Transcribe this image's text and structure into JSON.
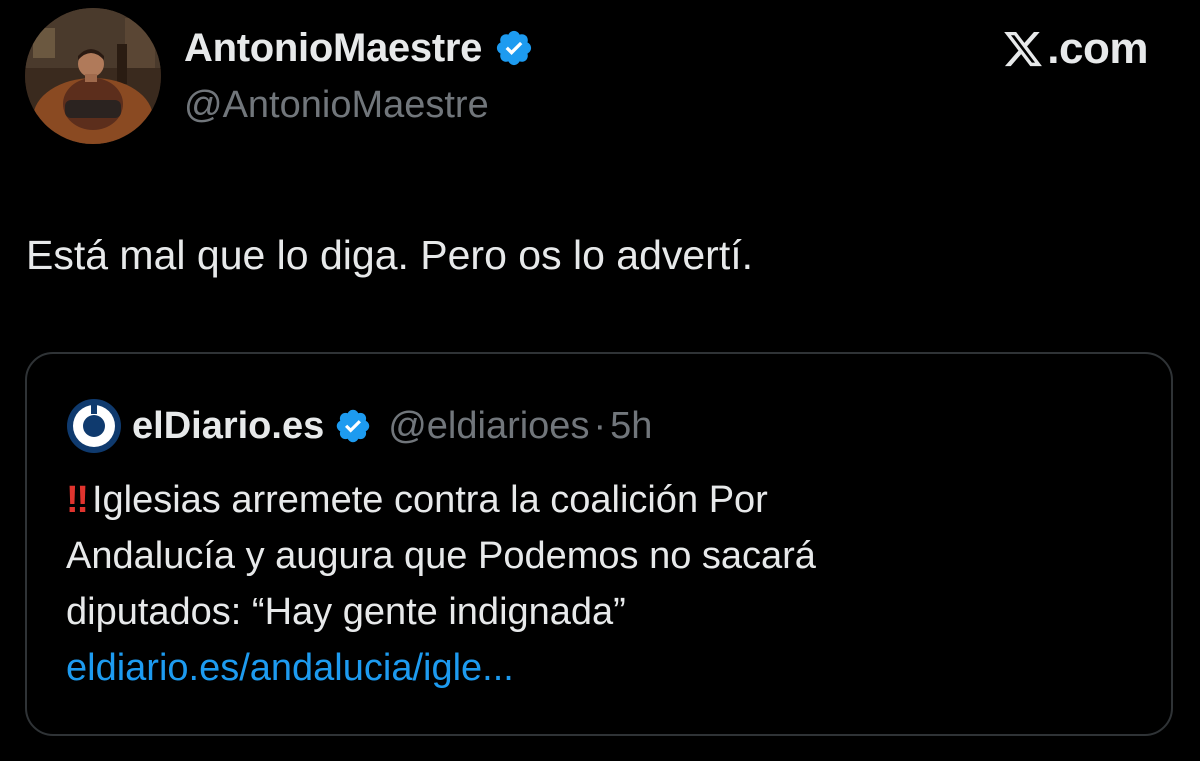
{
  "author": {
    "display_name": "AntonioMaestre",
    "handle": "@AntonioMaestre",
    "verified": true,
    "avatar_icon": "user-avatar-photo"
  },
  "brand": {
    "logo_icon": "x-logo-icon",
    "text": ".com"
  },
  "tweet": {
    "text": "Está mal que lo diga. Pero os lo advertí."
  },
  "quote": {
    "logo_icon": "eldiario-logo-icon",
    "name": "elDiario.es",
    "verified": true,
    "handle": "@eldiarioes",
    "separator": "·",
    "time": "5h",
    "alert_emoji": "‼",
    "text_line_1": "Iglesias arremete contra la coalición Por",
    "text_line_2": "Andalucía y augura que Podemos no sacará",
    "text_line_3": "diputados: “Hay gente indignada”",
    "link": "eldiario.es/andalucia/igle..."
  },
  "colors": {
    "background": "#000000",
    "text_primary": "#e7e9ea",
    "text_secondary": "#71767b",
    "link": "#1d9bf0",
    "verified_badge": "#1d9bf0",
    "border": "#2f3336",
    "alert": "#e0342e"
  }
}
